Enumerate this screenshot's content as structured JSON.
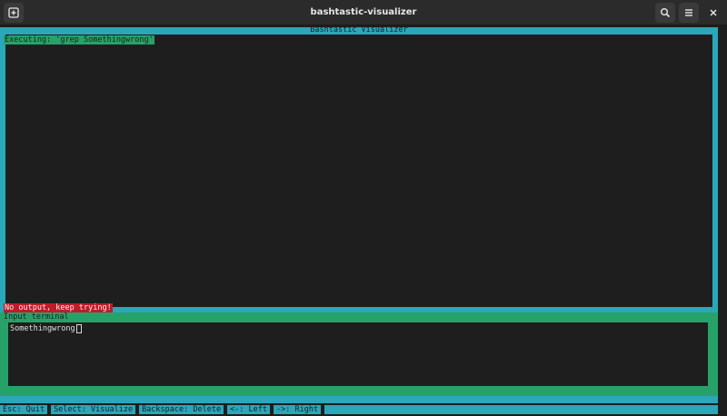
{
  "window": {
    "title": "bashtastic-visualizer"
  },
  "headerbar": {
    "icons": {
      "new_tab": "new-tab-icon",
      "search": "search-icon",
      "menu": "hamburger-menu-icon",
      "close": "close-icon"
    }
  },
  "visualizer": {
    "title": "Bashtastic Visualizer",
    "executing": "Executing: 'grep Somethingwrong'",
    "error_message": "No output, keep trying!"
  },
  "input": {
    "label": "Input terminal",
    "value": "Somethingwrong"
  },
  "statusbar": {
    "items": [
      "Esc: Quit",
      "Select: Visualize",
      "Backspace: Delete",
      "<-: Left",
      "->: Right"
    ]
  },
  "colors": {
    "cyan": "#2aa7b9",
    "green": "#26a269",
    "red": "#c01c28",
    "background": "#1e1e1e",
    "headerbar": "#2b2b2b"
  }
}
